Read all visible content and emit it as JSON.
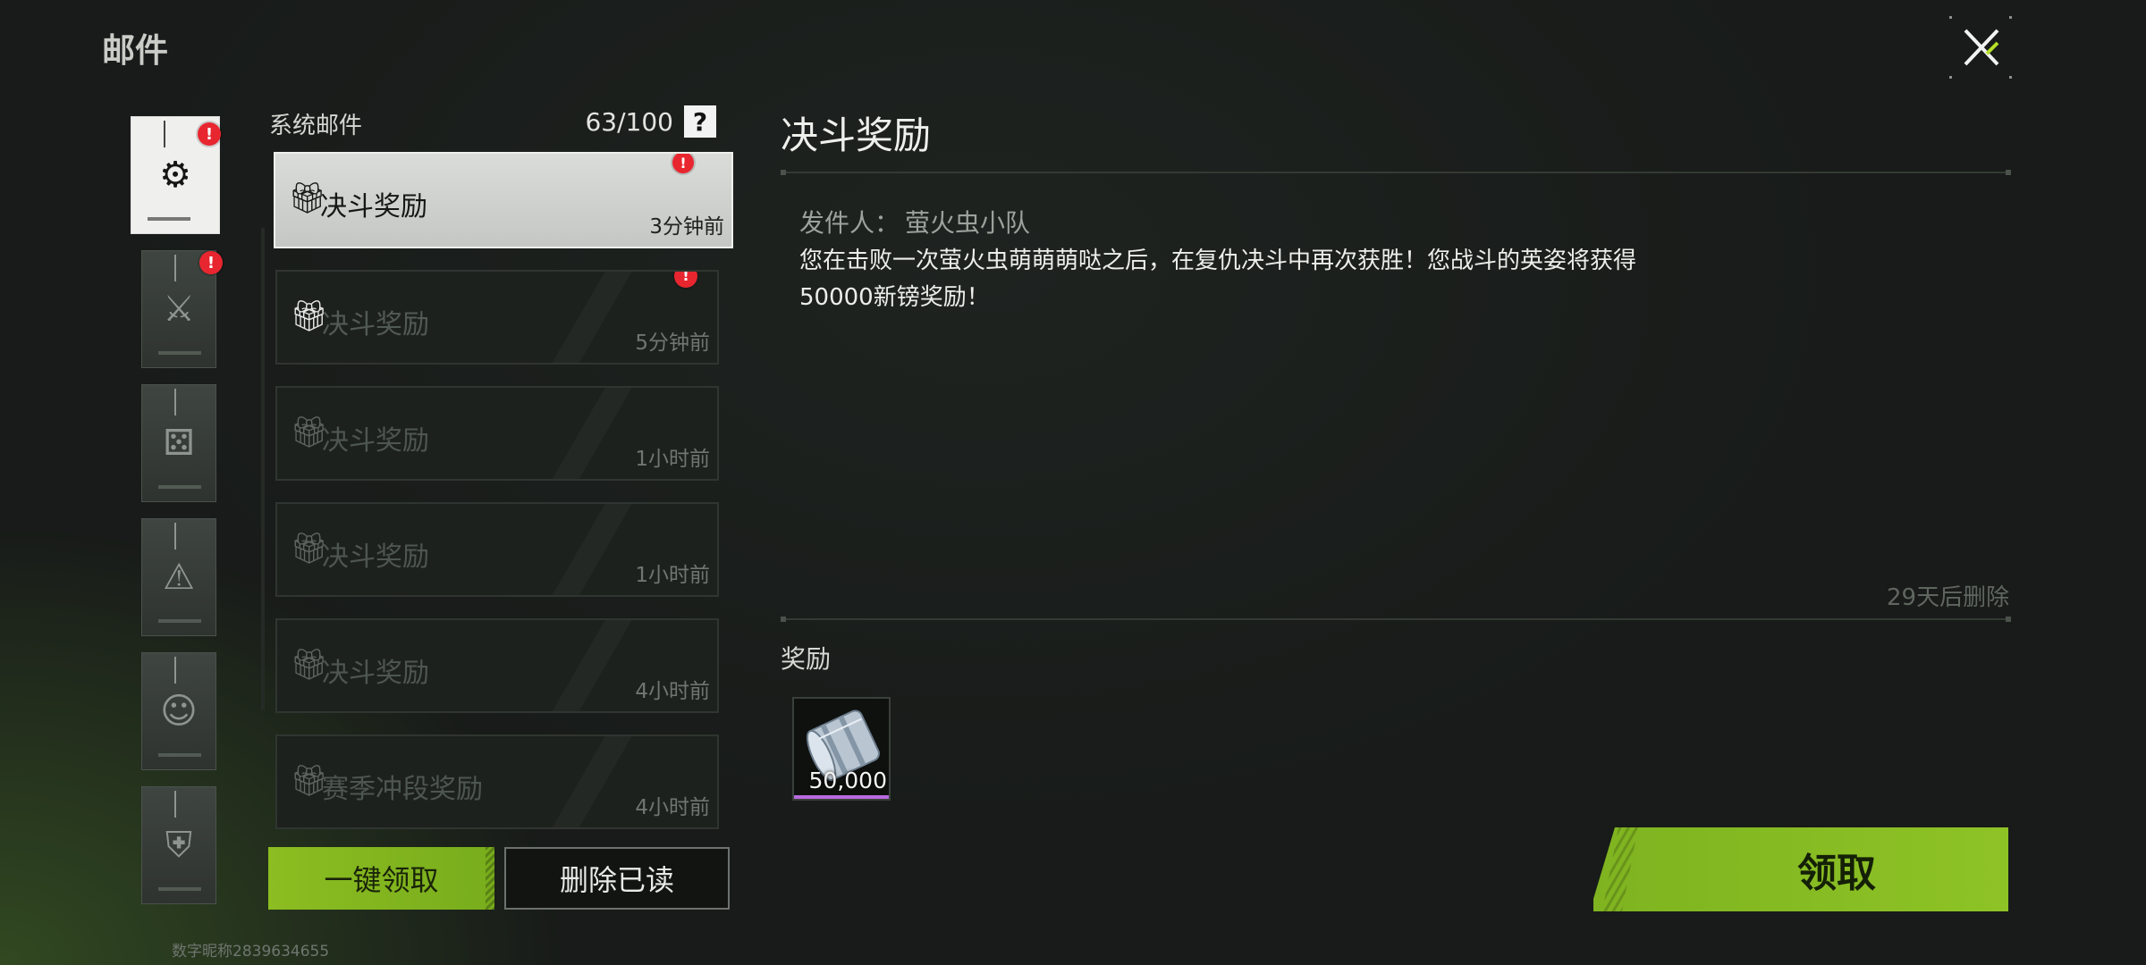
{
  "header": {
    "title": "邮件"
  },
  "categories": [
    {
      "icon": "gear-icon",
      "glyph": "⚙",
      "active": true,
      "badge": "!"
    },
    {
      "icon": "duel-icon",
      "glyph": "⚔",
      "active": false,
      "badge": "!"
    },
    {
      "icon": "dice-icon",
      "glyph": "⚄",
      "active": false,
      "badge": ""
    },
    {
      "icon": "warning-icon",
      "glyph": "⚠",
      "active": false,
      "badge": ""
    },
    {
      "icon": "character-icon",
      "glyph": "☺",
      "active": false,
      "badge": ""
    },
    {
      "icon": "armor-icon",
      "glyph": "⛨",
      "active": false,
      "badge": ""
    }
  ],
  "list": {
    "title": "系统邮件",
    "count": "63/100",
    "help": "?",
    "items": [
      {
        "subject": "决斗奖励",
        "time": "3分钟前",
        "badge": "!"
      },
      {
        "subject": "决斗奖励",
        "time": "5分钟前",
        "badge": "!"
      },
      {
        "subject": "决斗奖励",
        "time": "1小时前",
        "badge": ""
      },
      {
        "subject": "决斗奖励",
        "time": "1小时前",
        "badge": ""
      },
      {
        "subject": "决斗奖励",
        "time": "4小时前",
        "badge": ""
      },
      {
        "subject": "赛季冲段奖励",
        "time": "4小时前",
        "badge": ""
      }
    ]
  },
  "buttons": {
    "claim_all": "一键领取",
    "delete_read": "删除已读",
    "claim": "领取"
  },
  "user_id": "数字昵称2839634655",
  "detail": {
    "title": "决斗奖励",
    "sender_label": "发件人：",
    "sender_name": "萤火虫小队",
    "body_line1": "您在击败一次萤火虫萌萌萌哒之后，在复仇决斗中再次获胜！您战斗的英姿将获得",
    "body_line2": "50000新镑奖励！",
    "delete_note": "29天后删除",
    "reward_label": "奖励",
    "reward_qty": "50,000"
  },
  "colors": {
    "accent_green": "#8cbd21",
    "badge_red": "#e8262f",
    "rarity_purple": "#b86bdf"
  }
}
